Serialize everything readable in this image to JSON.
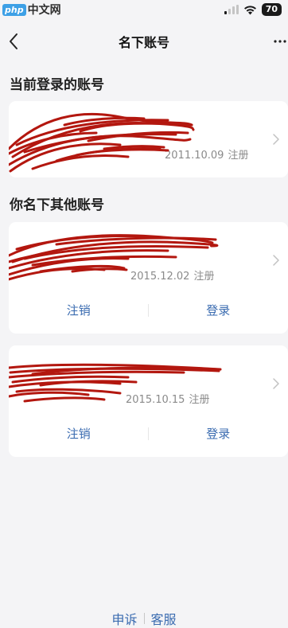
{
  "status_bar": {
    "watermark_brand": "php",
    "watermark_cn": "中文网",
    "battery": "70"
  },
  "nav": {
    "title": "名下账号"
  },
  "current_section": {
    "title": "当前登录的账号",
    "account": {
      "register_date": "2011.10.09",
      "register_label": "注册"
    }
  },
  "other_section": {
    "title": "你名下其他账号",
    "accounts": [
      {
        "register_date": "2015.12.02",
        "register_label": "注册",
        "cancel_label": "注销",
        "login_label": "登录"
      },
      {
        "register_date": "2015.10.15",
        "register_label": "注册",
        "cancel_label": "注销",
        "login_label": "登录"
      }
    ]
  },
  "footer": {
    "appeal": "申诉",
    "service": "客服"
  },
  "colors": {
    "background": "#f4f4f6",
    "card": "#ffffff",
    "link_blue": "#3a6bb0",
    "redaction_red": "#b3170f",
    "muted_text": "#8a8a8a"
  }
}
